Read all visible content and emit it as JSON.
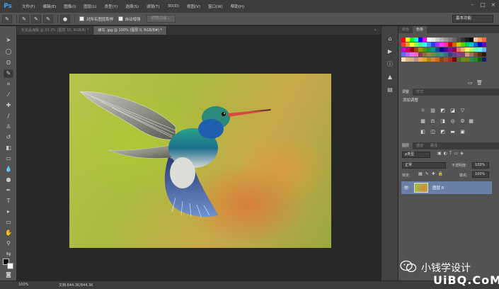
{
  "app": {
    "logo": "Ps"
  },
  "menu": [
    "文件(F)",
    "编辑(E)",
    "图像(I)",
    "图层(L)",
    "类型(Y)",
    "选择(S)",
    "滤镜(T)",
    "3D(D)",
    "视图(V)",
    "窗口(W)",
    "帮助(H)"
  ],
  "window_controls": {
    "minimize": "–",
    "restore": "□",
    "close": "×"
  },
  "options_bar": {
    "sample_all_layers": "对所有图层取样",
    "auto_enhance": "自动增强",
    "refine_edge": "调整边缘...",
    "workspace": "基本功能"
  },
  "tabs": [
    {
      "label": "化妆品海报 @ 33.3% (图层 10, RGB/8) *",
      "active": false
    },
    {
      "label": "蜂鸟 .jpg @ 100% (图层 0, RGB/8#) *",
      "active": true
    }
  ],
  "panels": {
    "color_tabs": [
      "颜色",
      "色板"
    ],
    "adjust_tabs": [
      "调整",
      "样式"
    ],
    "add_adjustment": "添加调整",
    "layers_tabs": [
      "图层",
      "通道",
      "路径"
    ],
    "filter_kind": "ρ类型",
    "blend_mode": "正常",
    "opacity_label": "不透明度:",
    "opacity_value": "100%",
    "lock_label": "锁定:",
    "fill_label": "填充:",
    "fill_value": "100%",
    "layer_name": "图层 0"
  },
  "status": {
    "zoom": "100%",
    "doc": "文档:844.3K/844.3K"
  },
  "watermark": {
    "cn": "小钱学设计",
    "url": "UiBQ.CoM"
  },
  "swatch_colors": {
    "row0": [
      "#ff0000",
      "#ffff00",
      "#00ff00",
      "#00ffff",
      "#0000ff",
      "#ff00ff",
      "#ffffff",
      "#e6e6e6",
      "#cccccc",
      "#b3b3b3",
      "#999999",
      "#808080",
      "#666666",
      "#4d4d4d",
      "#333333",
      "#1a1a1a",
      "#000000",
      "#ffcc99",
      "#ff9966",
      "#ff6633"
    ],
    "row1": [
      "#ff3333",
      "#ff9933",
      "#ffff33",
      "#99ff33",
      "#33ff99",
      "#33ffff",
      "#3399ff",
      "#3333ff",
      "#9933ff",
      "#ff33ff",
      "#ff3399",
      "#cc0000",
      "#cc6600",
      "#cccc00",
      "#66cc00",
      "#00cc66",
      "#00cccc",
      "#0066cc",
      "#0000cc",
      "#6600cc"
    ],
    "row2": [
      "#cc00cc",
      "#cc0066",
      "#990000",
      "#994c00",
      "#999900",
      "#4c9900",
      "#00994c",
      "#009999",
      "#004c99",
      "#000099",
      "#4c0099",
      "#990099",
      "#99004c",
      "#ff6666",
      "#ffb366",
      "#ffff66",
      "#b3ff66",
      "#66ffb3",
      "#66ffff",
      "#66b3ff"
    ],
    "row3": [
      "#6666ff",
      "#b366ff",
      "#ff66ff",
      "#ff66b3",
      "#8c3d3d",
      "#8c6d3d",
      "#8c8c3d",
      "#6d8c3d",
      "#3d8c6d",
      "#3d8c8c",
      "#3d6d8c",
      "#3d3d8c",
      "#6d3d8c",
      "#8c3d8c",
      "#8c3d6d",
      "#c8a070",
      "#a07850",
      "#785030",
      "#503018",
      "#2a1808"
    ],
    "row4": [
      "#f5deb3",
      "#deb887",
      "#d2b48c",
      "#bc8f8f",
      "#f4a460",
      "#daa520",
      "#b8860b",
      "#cd853f",
      "#d2691e",
      "#8b4513",
      "#a0522d",
      "#a52a2a",
      "#800000",
      "#556b2f",
      "#6b8e23",
      "#808000",
      "#2e8b57",
      "#228b22",
      "#006400",
      "#191970"
    ]
  }
}
